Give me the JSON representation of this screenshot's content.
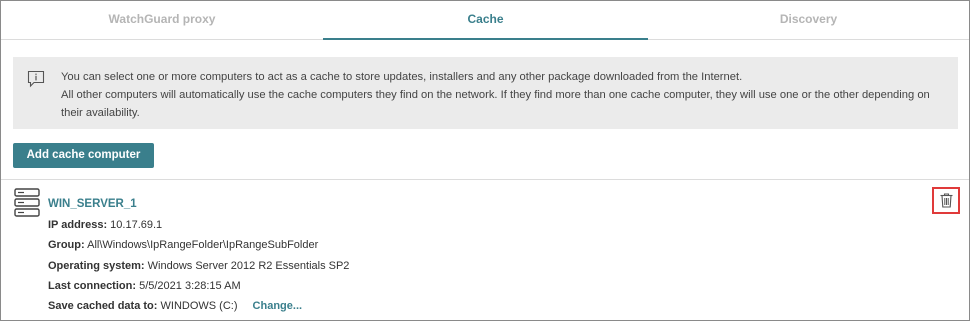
{
  "tabs": [
    {
      "label": "WatchGuard proxy"
    },
    {
      "label": "Cache"
    },
    {
      "label": "Discovery"
    }
  ],
  "info": {
    "line1": "You can select one or more computers to act as a cache to store updates, installers and any other package downloaded from the Internet.",
    "line2": "All other computers will automatically use the cache computers they find on the network. If they find more than one cache computer, they will use one or the other depending on their availability."
  },
  "add_button_label": "Add cache computer",
  "computer": {
    "name": "WIN_SERVER_1",
    "ip_label": "IP address:",
    "ip_value": "10.17.69.1",
    "group_label": "Group:",
    "group_value": "All\\Windows\\IpRangeFolder\\IpRangeSubFolder",
    "os_label": "Operating system:",
    "os_value": "Windows Server 2012 R2 Essentials SP2",
    "last_label": "Last connection:",
    "last_value": "5/5/2021 3:28:15 AM",
    "save_label": "Save cached data to:",
    "save_value": "WINDOWS (C:)",
    "change_label": "Change..."
  },
  "icons": {
    "info": "info-comment-icon",
    "server": "server-icon",
    "delete": "trash-icon"
  },
  "colors": {
    "accent": "#3a7f8c",
    "highlight": "#e03a3a"
  }
}
